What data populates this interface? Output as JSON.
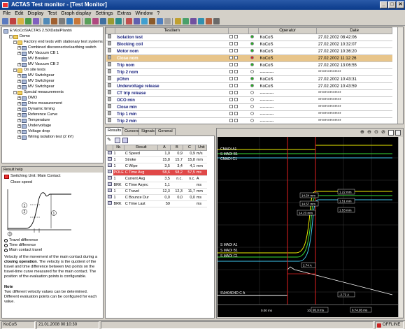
{
  "window": {
    "title": "ACTAS Test monitor - [Test Monitor]",
    "min": "_",
    "max": "□",
    "close": "✕"
  },
  "menu": [
    "File",
    "Edit",
    "Display",
    "Test",
    "Graph display",
    "Settings",
    "Extras",
    "Window",
    "?"
  ],
  "tree": {
    "root": "E:\\KoCoS\\ACTAS 2.50\\Data\\Plants\\",
    "items": [
      {
        "label": "Demo",
        "level": 1
      },
      {
        "label": "Factory end tests with stationary test systems",
        "level": 2
      },
      {
        "label": "Combined disconnector/earthing switch",
        "level": 3
      },
      {
        "label": "MV Vacuum CB 1",
        "level": 3
      },
      {
        "label": "MV Breaker",
        "level": 4
      },
      {
        "label": "MV Vacuum CB 2",
        "level": 3
      },
      {
        "label": "On site tests",
        "level": 2
      },
      {
        "label": "MV Switchgear",
        "level": 3
      },
      {
        "label": "MV Switchgear",
        "level": 3
      },
      {
        "label": "MV Switchgear",
        "level": 3
      },
      {
        "label": "Special measurements",
        "level": 2
      },
      {
        "label": "DMO",
        "level": 3
      },
      {
        "label": "Drive measurement",
        "level": 3
      },
      {
        "label": "Dynamic timing",
        "level": 3
      },
      {
        "label": "Reference Curve",
        "level": 3
      },
      {
        "label": "Temperature",
        "level": 3
      },
      {
        "label": "Undervoltage",
        "level": 3
      },
      {
        "label": "Voltage drop",
        "level": 3
      },
      {
        "label": "Wiring isolation test (2 kV)",
        "level": 3
      }
    ]
  },
  "info": {
    "header": "Result help",
    "unit_title": "Switching Unit: Main Contact",
    "measure": "Close speed",
    "legend": [
      "Travel difference",
      "Time difference",
      "Main contact travel"
    ],
    "para1a": "Velocity of the movement of the main contact during a ",
    "para1b": "closing operation",
    "para1c": ". The velocity is the quotient of the travel and time difference between two points on the travel-time curve measured for the main contact. The position of the evaluation points is configurable.",
    "note_title": "Note",
    "note": "Two different velocity values can be determined. Different evaluation points can be configured for each value."
  },
  "testtable": {
    "headers": [
      "Testitem",
      "",
      "",
      "Operator",
      "Date"
    ],
    "rows": [
      {
        "name": "Isolation test",
        "status": "green",
        "op": "KoCoS",
        "date": "27.02.2002 08:42:06"
      },
      {
        "name": "Blocking coil",
        "status": "green",
        "op": "KoCoS",
        "date": "27.02.2002 10:32:07"
      },
      {
        "name": "Motor nom",
        "status": "green",
        "op": "KoCoS",
        "date": "27.02.2002 10:36:20"
      },
      {
        "name": "Close nom",
        "status": "red",
        "op": "KoCoS",
        "date": "27.02.2002 11:12:26",
        "hl": true
      },
      {
        "name": "Trip nom",
        "status": "green",
        "op": "KoCoS",
        "date": "27.02.2002 13:06:55"
      },
      {
        "name": "Trip 2 nom",
        "status": "none",
        "op": "----------",
        "date": "**************"
      },
      {
        "name": "pOhm",
        "status": "green",
        "op": "KoCoS",
        "date": "27.02.2002 10:43:31"
      },
      {
        "name": "Undervoltage release",
        "status": "green",
        "op": "KoCoS",
        "date": "27.02.2002 10:43:59"
      },
      {
        "name": "CT trip release",
        "status": "none",
        "op": "----------",
        "date": "**************"
      },
      {
        "name": "OCO min",
        "status": "none",
        "op": "----------",
        "date": "**************"
      },
      {
        "name": "Close min",
        "status": "none",
        "op": "----------",
        "date": "**************"
      },
      {
        "name": "Trip 1 min",
        "status": "none",
        "op": "----------",
        "date": "**************"
      },
      {
        "name": "Trip 2 min",
        "status": "none",
        "op": "----------",
        "date": "**************"
      }
    ]
  },
  "tabs": [
    "Results",
    "Cursors",
    "Signals",
    "General"
  ],
  "results": {
    "headers": [
      "Nr.",
      "Result",
      "A",
      "B",
      "C",
      "Unit"
    ],
    "rows": [
      {
        "nr": "1",
        "name": "C Speed",
        "a": "1,0",
        "b": "0,9",
        "c": "0,9",
        "unit": "m/s"
      },
      {
        "nr": "1",
        "name": "Stroke",
        "a": "15,8",
        "b": "15,7",
        "c": "15,8",
        "unit": "mm"
      },
      {
        "nr": "1",
        "name": "C Wipe",
        "a": "3,5",
        "b": "3,4",
        "c": "4,1",
        "unit": "mm"
      },
      {
        "nr": "POLE",
        "name": "C Time Avg",
        "a": "58,6",
        "b": "58,2",
        "c": "57,5",
        "unit": "ms",
        "red": true
      },
      {
        "nr": "1",
        "name": "Current Avg",
        "a": "3,5",
        "b": "n.c.",
        "c": "n.c.",
        "unit": "A"
      },
      {
        "nr": "BRK",
        "name": "C Time Async",
        "a": "1,1",
        "b": "",
        "c": "",
        "unit": "ms"
      },
      {
        "nr": "1",
        "name": "C Travel",
        "a": "12,3",
        "b": "12,3",
        "c": "11,7",
        "unit": "mm"
      },
      {
        "nr": "1",
        "name": "C Bounce Dur",
        "a": "0,0",
        "b": "0,0",
        "c": "0,0",
        "unit": "ms"
      },
      {
        "nr": "BRK",
        "name": "C Time Last",
        "a": "59",
        "b": "",
        "c": "",
        "unit": "ms"
      }
    ]
  },
  "graph": {
    "labels_top": [
      "CMADI A1",
      "S MADI B1",
      "CMADI C1"
    ],
    "labels_mid": [
      "S MADI A1",
      "S MADI B1",
      "S MADI C1"
    ],
    "label_bottom": "S\\0404D4D C A",
    "cursor_vals": [
      "14.54 mm",
      "14.57 mm",
      "14.23 mm",
      "1.22 mm",
      "1.51 mm",
      "1.53 mm",
      "2.74 A",
      "-2.72 A"
    ],
    "xaxis": [
      "0.00 ms",
      "10",
      "95.0 ms",
      "6:74.95 ms"
    ]
  },
  "status": {
    "user": "KoCoS",
    "datetime": "21.01.2008 00:10:30",
    "mode": "OFFLINE"
  },
  "colors": {
    "yellow": "#f0f000",
    "green": "#38e038",
    "cyan": "#40c8f0",
    "red": "#e02020"
  }
}
